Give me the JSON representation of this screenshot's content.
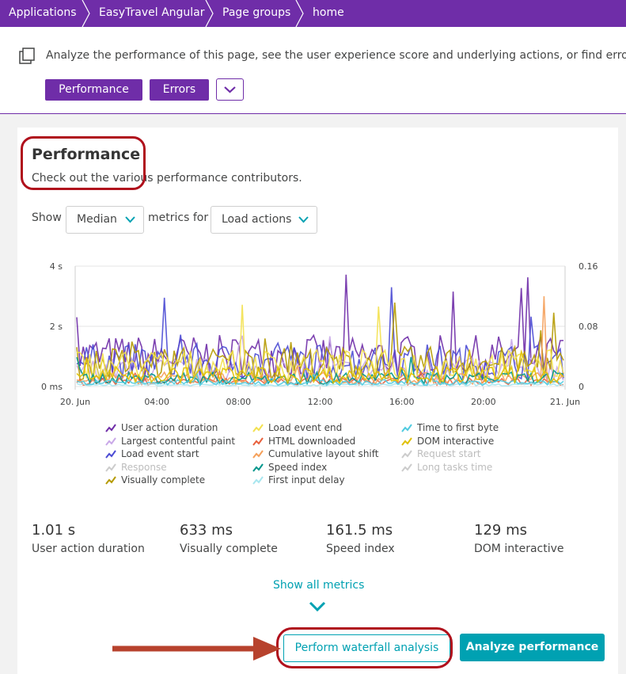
{
  "breadcrumb": [
    "Applications",
    "EasyTravel Angular",
    "Page groups",
    "home"
  ],
  "header": {
    "description": "Analyze the performance of this page, see the user experience score and underlying actions, or find errors",
    "tabs": [
      "Performance",
      "Errors"
    ]
  },
  "card": {
    "title": "Performance",
    "subtitle": "Check out the various performance contributors.",
    "show_label": "Show",
    "aggregation_value": "Median",
    "metrics_for_label": "metrics for",
    "action_type_value": "Load actions"
  },
  "chart_data": {
    "type": "line",
    "x_ticks": [
      "20. Jun",
      "04:00",
      "08:00",
      "12:00",
      "16:00",
      "20:00",
      "21. Jun"
    ],
    "y_left_ticks": [
      "0 ms",
      "2 s",
      "4 s"
    ],
    "y_right_ticks": [
      "0",
      "0.08",
      "0.16"
    ],
    "ylim_left": [
      0,
      4
    ],
    "ylim_right": [
      0,
      0.16
    ],
    "grid": true,
    "series": [
      {
        "name": "User action duration",
        "color": "#6f2da8"
      },
      {
        "name": "Largest contentful paint",
        "color": "#c9a8e8"
      },
      {
        "name": "Load event start",
        "color": "#4b4bd4"
      },
      {
        "name": "Response",
        "color": "#cccccc",
        "disabled": true
      },
      {
        "name": "Visually complete",
        "color": "#b59a00"
      },
      {
        "name": "Load event end",
        "color": "#f3e14f"
      },
      {
        "name": "HTML downloaded",
        "color": "#e8603c"
      },
      {
        "name": "Cumulative layout shift",
        "color": "#f5a05a"
      },
      {
        "name": "Speed index",
        "color": "#00968c"
      },
      {
        "name": "First input delay",
        "color": "#a8e6ef"
      },
      {
        "name": "Time to first byte",
        "color": "#4fcbe0"
      },
      {
        "name": "DOM interactive",
        "color": "#e0c000"
      },
      {
        "name": "Request start",
        "color": "#cccccc",
        "disabled": true
      },
      {
        "name": "Long tasks time",
        "color": "#cccccc",
        "disabled": true
      }
    ]
  },
  "metrics": [
    {
      "value": "1.01 s",
      "label": "User action duration"
    },
    {
      "value": "633 ms",
      "label": "Visually complete"
    },
    {
      "value": "161.5 ms",
      "label": "Speed index"
    },
    {
      "value": "129 ms",
      "label": "DOM interactive"
    }
  ],
  "show_all_label": "Show all metrics",
  "buttons": {
    "waterfall": "Perform waterfall analysis",
    "analyze": "Analyze performance"
  },
  "colors": {
    "brand": "#6f2da8",
    "accent": "#00a1b2",
    "highlight": "#b0101c"
  }
}
